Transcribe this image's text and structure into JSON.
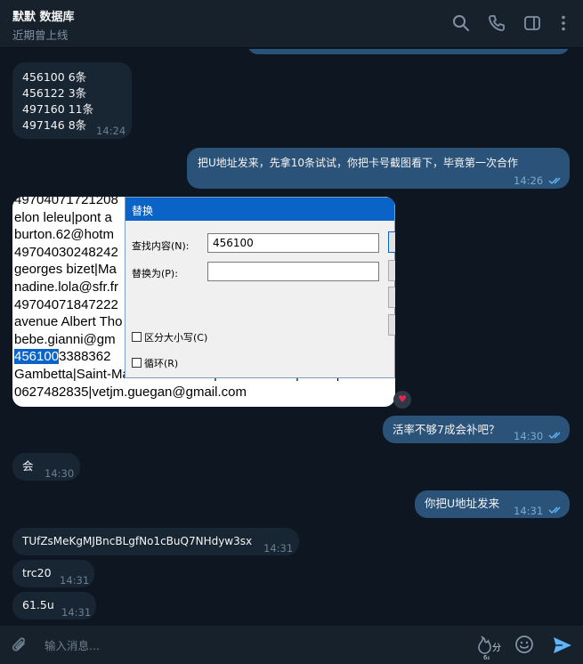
{
  "header": {
    "contact_name": "默默 数据库",
    "status": "近期曾上线"
  },
  "messages": {
    "m1": {
      "lines": [
        "456100  6条",
        "456122  3条",
        "497160  11条",
        "497146  8条"
      ],
      "time": "14:24"
    },
    "m2": {
      "text": "把U地址发来，先拿10条试试，你把卡号截图看下，毕竟第一次合作",
      "time": "14:26"
    },
    "m3": {
      "text": "活率不够7成会补吧？",
      "time": "14:30"
    },
    "m4": {
      "text": "会",
      "time": "14:30"
    },
    "m5": {
      "text": "你把U地址发来",
      "time": "14:31"
    },
    "m6": {
      "text": "TUfZsMeKgMJBncBLgfNo1cBuQ7NHdyw3sx",
      "time": "14:31"
    },
    "m7": {
      "text": "trc20",
      "time": "14:31"
    },
    "m8": {
      "text": "61.5u",
      "time": "14:31"
    }
  },
  "screenshot": {
    "lines": [
      "49704071721208",
      "elon leleu|pont a",
      "burton.62@hotm",
      "49704030248242",
      "georges bizet|Ma",
      "nadine.lola@sfr.fr",
      "49704071847222",
      "avenue Albert Tho",
      "bebe.gianni@gm",
      "3388362",
      "Gambetta|Saint-Maur des Fosses|Val de Marne|94100|",
      "0627482835|vetjm.guegan@gmail.com"
    ],
    "highlight": "456100",
    "dialog": {
      "title": "替换",
      "find_label": "查找内容(N):",
      "find_value": "456100",
      "replace_label": "替换为(P):",
      "replace_value": "",
      "match_case": "区分大小写(C)",
      "wrap": "循环(R)"
    }
  },
  "composer": {
    "placeholder": "输入消息...",
    "voice_badge": "分",
    "voice_sub": "6₆"
  },
  "colors": {
    "background": "#0e1621",
    "header": "#17212b",
    "incoming": "#182533",
    "outgoing": "#2b5278",
    "accent": "#5eb5f7"
  }
}
